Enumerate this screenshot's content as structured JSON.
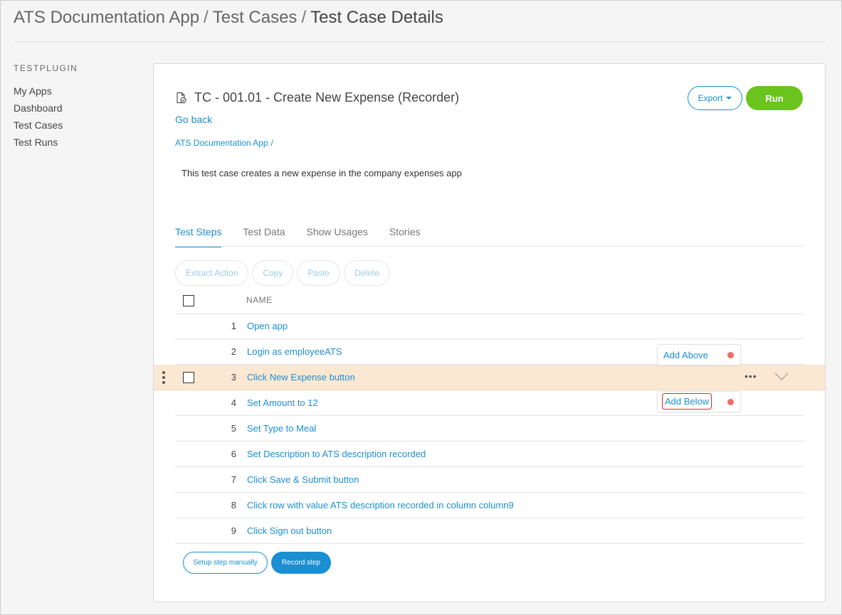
{
  "breadcrumb": {
    "app": "ATS Documentation App",
    "section": "Test Cases",
    "current": "Test Case Details",
    "separator": "/"
  },
  "sidebar": {
    "title": "TESTPLUGIN",
    "items": [
      {
        "label": "My Apps"
      },
      {
        "label": "Dashboard"
      },
      {
        "label": "Test Cases"
      },
      {
        "label": "Test Runs"
      }
    ]
  },
  "test_case": {
    "icon": "test-case-doc-icon",
    "title": "TC - 001.01 - Create New Expense (Recorder)",
    "go_back": "Go back",
    "app_crumb": "ATS Documentation App",
    "app_crumb_sep": "/",
    "description": "This test case creates a new expense in the company expenses app"
  },
  "toolbar": {
    "export_label": "Export",
    "run_label": "Run"
  },
  "tabs": [
    {
      "label": "Test Steps",
      "active": true
    },
    {
      "label": "Test Data",
      "active": false
    },
    {
      "label": "Show Usages",
      "active": false
    },
    {
      "label": "Stories",
      "active": false
    }
  ],
  "step_actions": [
    {
      "label": "Extract Action"
    },
    {
      "label": "Copy"
    },
    {
      "label": "Paste"
    },
    {
      "label": "Delete"
    }
  ],
  "table": {
    "column_name": "NAME",
    "steps": [
      {
        "num": "1",
        "name": "Open app"
      },
      {
        "num": "2",
        "name": "Login as employeeATS"
      },
      {
        "num": "3",
        "name": "Click New Expense button",
        "highlighted": true
      },
      {
        "num": "4",
        "name": "Set Amount to 12"
      },
      {
        "num": "5",
        "name": "Set Type to Meal"
      },
      {
        "num": "6",
        "name": "Set Description to ATS description recorded"
      },
      {
        "num": "7",
        "name": "Click Save & Submit button"
      },
      {
        "num": "8",
        "name": "Click row with value ATS description recorded in column column9"
      },
      {
        "num": "9",
        "name": "Click Sign out button"
      }
    ]
  },
  "popovers": {
    "add_above": "Add Above",
    "add_below": "Add Below"
  },
  "bottom_buttons": {
    "setup": "Setup step manually",
    "record": "Record step"
  },
  "colors": {
    "accent": "#1a8fd1",
    "run": "#6ac41d",
    "highlight_row": "#fbe8d3",
    "record_dot": "#f26b6b",
    "focus_outline": "#e0282b"
  }
}
